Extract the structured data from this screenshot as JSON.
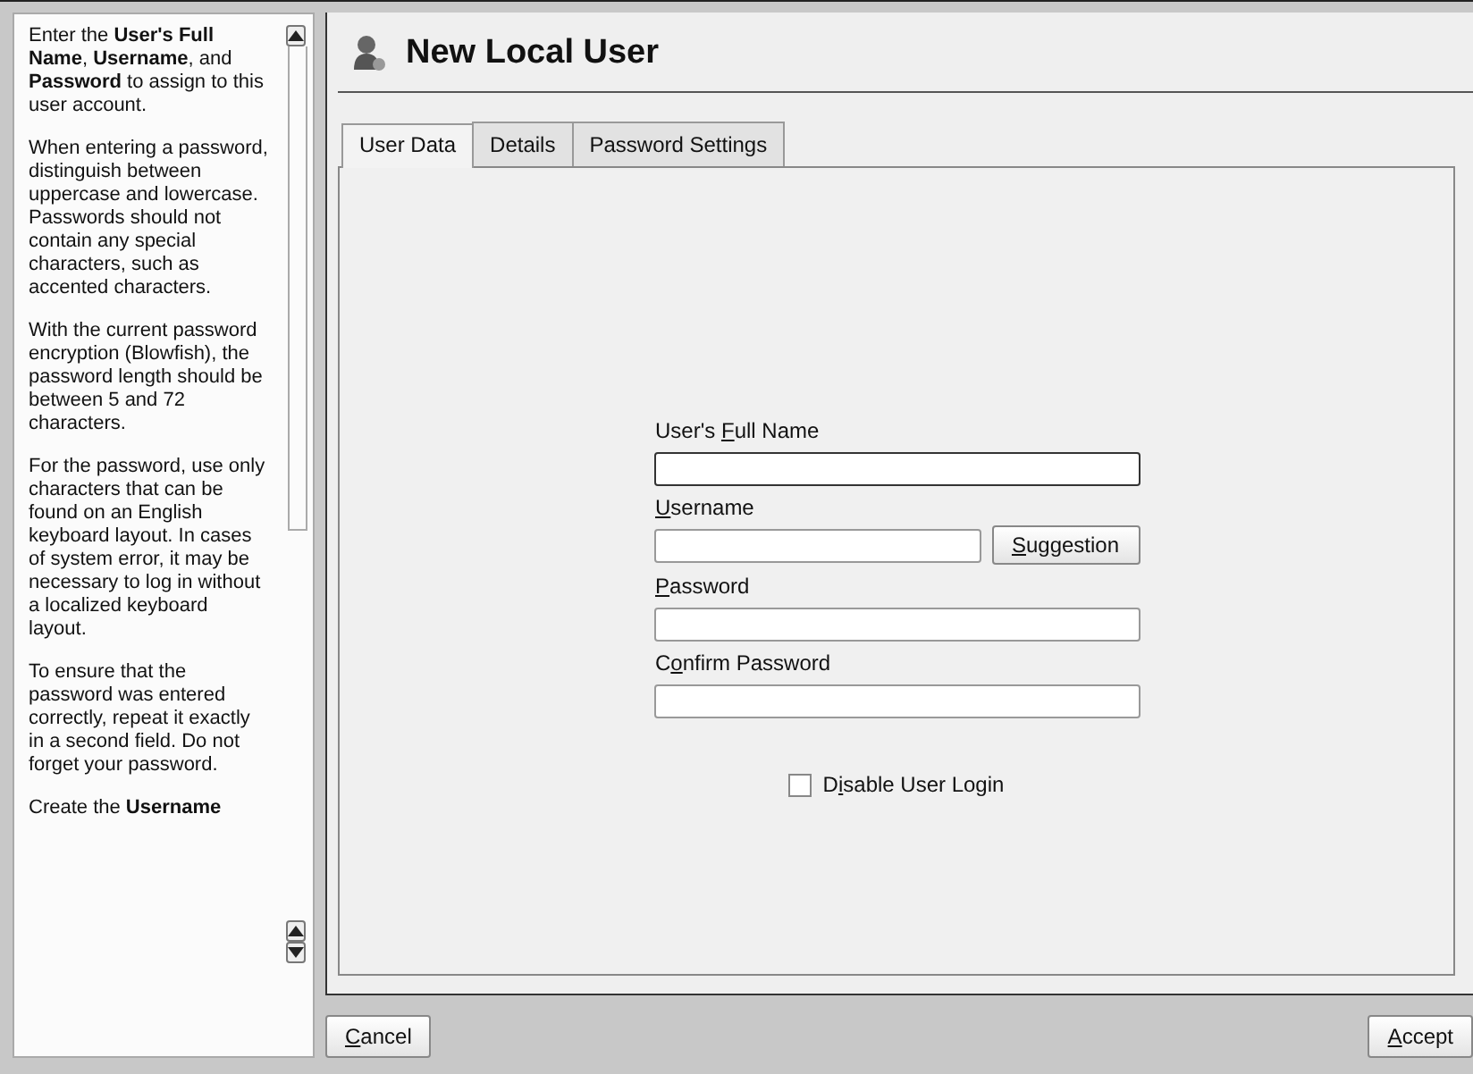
{
  "help": {
    "paragraphs": [
      "Enter the **User's Full Name**, **Username**, and **Password** to assign to this user account.",
      "When entering a password, distinguish between uppercase and lowercase. Passwords should not contain any special characters, such as accented characters.",
      "With the current password encryption (Blowfish), the password length should be between 5 and 72 characters.",
      "For the password, use only characters that can be found on an English keyboard layout. In cases of system error, it may be necessary to log in without a localized keyboard layout.",
      "To ensure that the password was entered correctly, repeat it exactly in a second field. Do not forget your password.",
      "Create the **Username**"
    ]
  },
  "dialog": {
    "title": "New Local User"
  },
  "tabs": [
    {
      "label": "User Data",
      "selected": true
    },
    {
      "label": "Details",
      "selected": false
    },
    {
      "label": "Password Settings",
      "selected": false
    }
  ],
  "fields": [
    {
      "label": {
        "pre": "User's ",
        "key": "F",
        "post": "ull Name"
      },
      "focused": true
    },
    {
      "label": {
        "key": "U",
        "post": "sername"
      },
      "focused": false,
      "button": {
        "key": "S",
        "post": "uggestion"
      }
    },
    {
      "label": {
        "key": "P",
        "post": "assword"
      },
      "focused": false
    },
    {
      "label": {
        "pre": "C",
        "key": "o",
        "post": "nfirm Password"
      },
      "focused": false
    }
  ],
  "disable_login": {
    "label": {
      "pre": "D",
      "key": "i",
      "post": "sable User Login"
    },
    "checked": false
  },
  "buttons": [
    {
      "key": "C",
      "post": "ancel"
    },
    {
      "key": "A",
      "post": "ccept"
    }
  ]
}
